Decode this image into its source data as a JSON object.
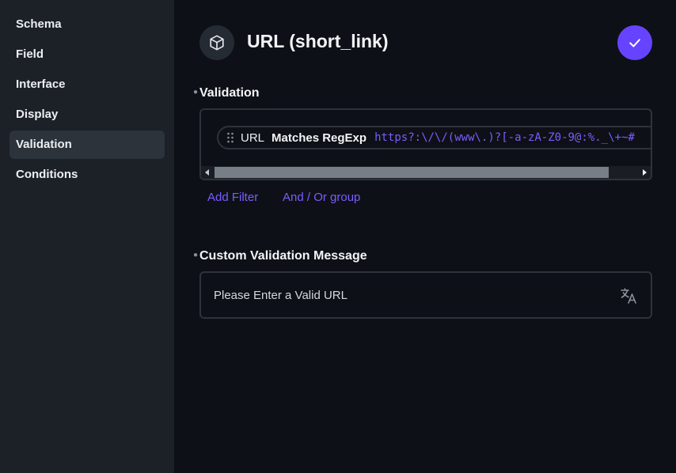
{
  "sidebar": {
    "items": [
      {
        "label": "Schema"
      },
      {
        "label": "Field"
      },
      {
        "label": "Interface"
      },
      {
        "label": "Display"
      },
      {
        "label": "Validation",
        "active": true
      },
      {
        "label": "Conditions"
      }
    ]
  },
  "header": {
    "icon": "cube-icon",
    "title": "URL (short_link)",
    "save_icon": "check-icon"
  },
  "validation": {
    "label": "Validation",
    "filter": {
      "field": "URL",
      "operator": "Matches RegExp",
      "value": "https?:\\/\\/(www\\.)?[-a-zA-Z0-9@:%._\\+~#"
    },
    "add_filter": "Add Filter",
    "and_or_group": "And / Or group"
  },
  "custom_message": {
    "label": "Custom Validation Message",
    "value": "Please Enter a Valid URL",
    "icon": "translate-icon"
  },
  "colors": {
    "accent": "#6644ff",
    "sidebar_bg": "#1c2128",
    "main_bg": "#0d1117"
  }
}
